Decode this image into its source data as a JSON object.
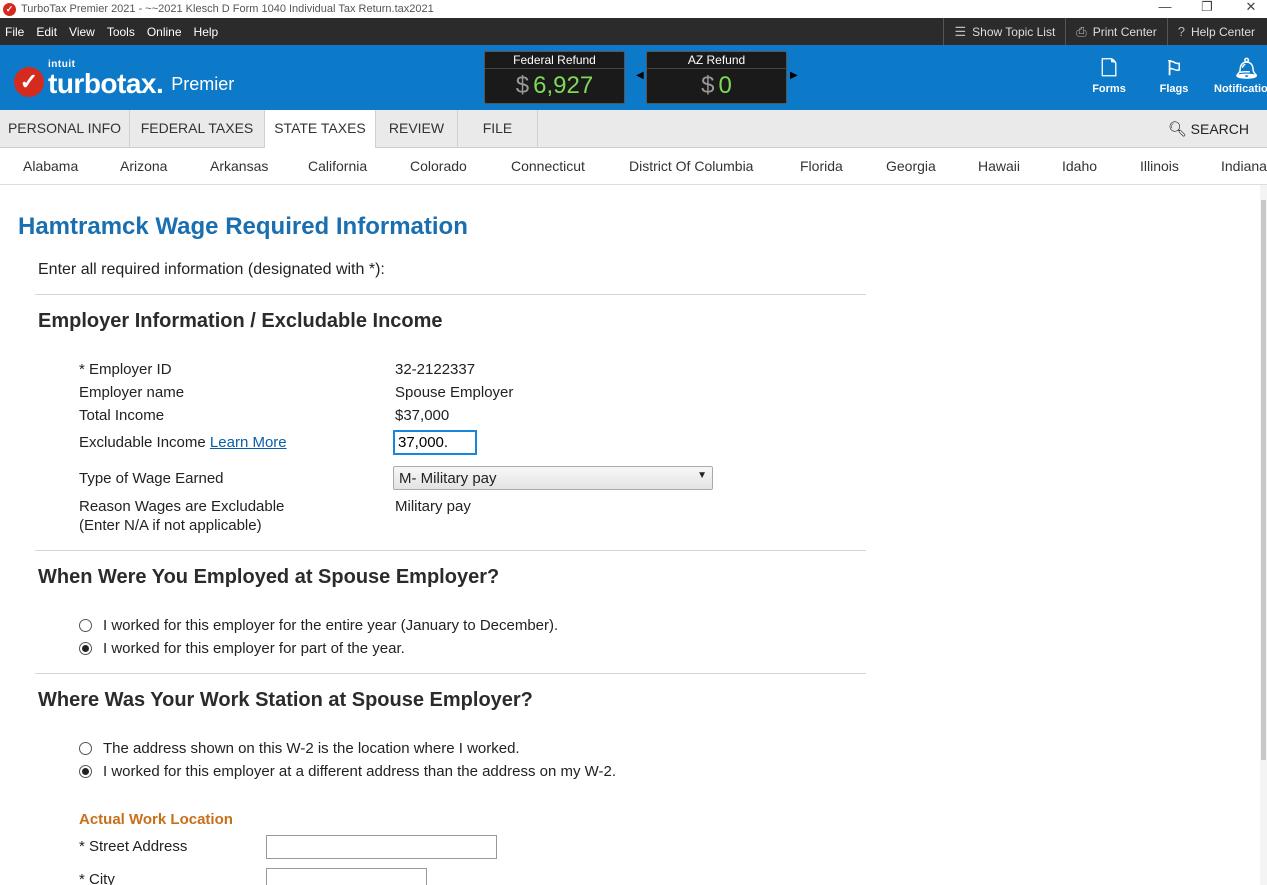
{
  "window": {
    "title": "TurboTax Premier 2021 - ~~2021 Klesch D Form 1040  Individual Tax Return.tax2021",
    "minimize": "—",
    "restore": "❐",
    "close": "✕"
  },
  "menu": {
    "items": [
      "File",
      "Edit",
      "View",
      "Tools",
      "Online",
      "Help"
    ],
    "tools": {
      "topic_list": "Show Topic List",
      "print_center": "Print Center",
      "help_center": "Help Center"
    }
  },
  "brand": {
    "intuit": "intuit",
    "name": "turbotax.",
    "edition": "Premier"
  },
  "refunds": {
    "federal_label": "Federal Refund",
    "federal_currency": "$",
    "federal_amount": "6,927",
    "state_label": "AZ Refund",
    "state_currency": "$",
    "state_amount": "0"
  },
  "brand_buttons": {
    "forms": "Forms",
    "flags": "Flags",
    "notifications": "Notifications"
  },
  "tabs": [
    "PERSONAL INFO",
    "FEDERAL TAXES",
    "STATE TAXES",
    "REVIEW",
    "FILE"
  ],
  "active_tab": "STATE TAXES",
  "search_label": "SEARCH",
  "states": [
    "Alabama",
    "Arizona",
    "Arkansas",
    "California",
    "Colorado",
    "Connecticut",
    "District Of Columbia",
    "Florida",
    "Georgia",
    "Hawaii",
    "Idaho",
    "Illinois",
    "Indiana"
  ],
  "page": {
    "title": "Hamtramck Wage Required Information",
    "intro": "Enter all required information (designated with *):",
    "employer_section": {
      "heading": "Employer Information / Excludable Income",
      "employer_id_label": "* Employer ID",
      "employer_id_value": "32-2122337",
      "employer_name_label": "Employer name",
      "employer_name_value": "Spouse Employer",
      "total_income_label": "Total Income",
      "total_income_value": "$37,000",
      "excludable_label": "Excludable Income",
      "learn_more": "Learn More",
      "excludable_value": "37,000.",
      "wage_type_label": "Type of Wage Earned",
      "wage_type_value": "M- Military pay",
      "reason_label_1": "Reason Wages are Excludable",
      "reason_label_2": "(Enter N/A if not applicable)",
      "reason_value": "Military pay"
    },
    "employment_section": {
      "heading": "When Were You Employed at Spouse Employer?",
      "option_full": "I worked for this employer for the entire year (January to December).",
      "option_part": "I worked for this employer for part of the year.",
      "selected": "part"
    },
    "workstation_section": {
      "heading": "Where Was Your Work Station at Spouse Employer?",
      "option_w2": "The address shown on this W-2 is the location where I worked.",
      "option_diff": "I worked for this employer at a different address than the address on my W-2.",
      "selected": "diff"
    },
    "work_location": {
      "heading": "Actual Work Location",
      "street_label": "* Street Address",
      "street_value": "",
      "city_label": "* City",
      "city_value": ""
    }
  },
  "colors": {
    "brand_blue": "#0d7ac9",
    "title_blue": "#1a6fb0",
    "refund_green": "#7ed957",
    "accent_orange": "#c86f1a",
    "turbotax_red": "#d52b1e"
  },
  "icons": {
    "topic_list": "list-icon",
    "print_center": "printer-icon",
    "help_center": "help-icon",
    "forms": "document-icon",
    "flags": "flag-icon",
    "notifications": "bell-icon",
    "search": "magnifier-icon"
  }
}
